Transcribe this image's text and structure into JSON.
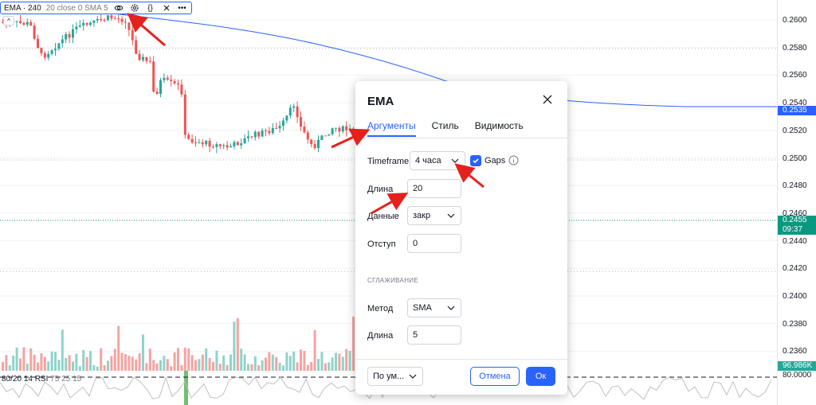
{
  "legend": {
    "name": "EMA · 240",
    "params": "20 close 0 SMA 5"
  },
  "rsi": {
    "levels": "80/20",
    "name": "14 RSI",
    "params": "75 25 15"
  },
  "price_scale": {
    "ticks": [
      "0.2600",
      "0.2580",
      "0.2560",
      "0.2540",
      "0.2520",
      "0.2500",
      "0.2480",
      "0.2460",
      "0.2440",
      "0.2420",
      "0.2400",
      "0.2380",
      "0.2360"
    ],
    "ema_tag": "0.2535",
    "last_price": "0.2455",
    "countdown": "09:37",
    "volume_tag": "96.986K",
    "rsi_tag": "80.0000"
  },
  "dialog": {
    "title": "EMA",
    "tabs": [
      {
        "label": "Аргументы",
        "active": true
      },
      {
        "label": "Стиль",
        "active": false
      },
      {
        "label": "Видимость",
        "active": false
      }
    ],
    "timeframe_label": "Timeframe",
    "timeframe_value": "4 часа",
    "gaps_label": "Gaps",
    "gaps_checked": true,
    "length_label": "Длина",
    "length_value": "20",
    "source_label": "Данные",
    "source_value": "закр",
    "offset_label": "Отступ",
    "offset_value": "0",
    "smoothing_header": "СГЛАЖИВАНИЕ",
    "method_label": "Метод",
    "method_value": "SMA",
    "smoothing_length_label": "Длина",
    "smoothing_length_value": "5",
    "defaults_label": "По ум...",
    "cancel_label": "Отмена",
    "ok_label": "Ок"
  },
  "colors": {
    "accent": "#2962ff",
    "up": "#26a69a",
    "down": "#ef5350",
    "annotation_arrow": "#e5211d"
  }
}
